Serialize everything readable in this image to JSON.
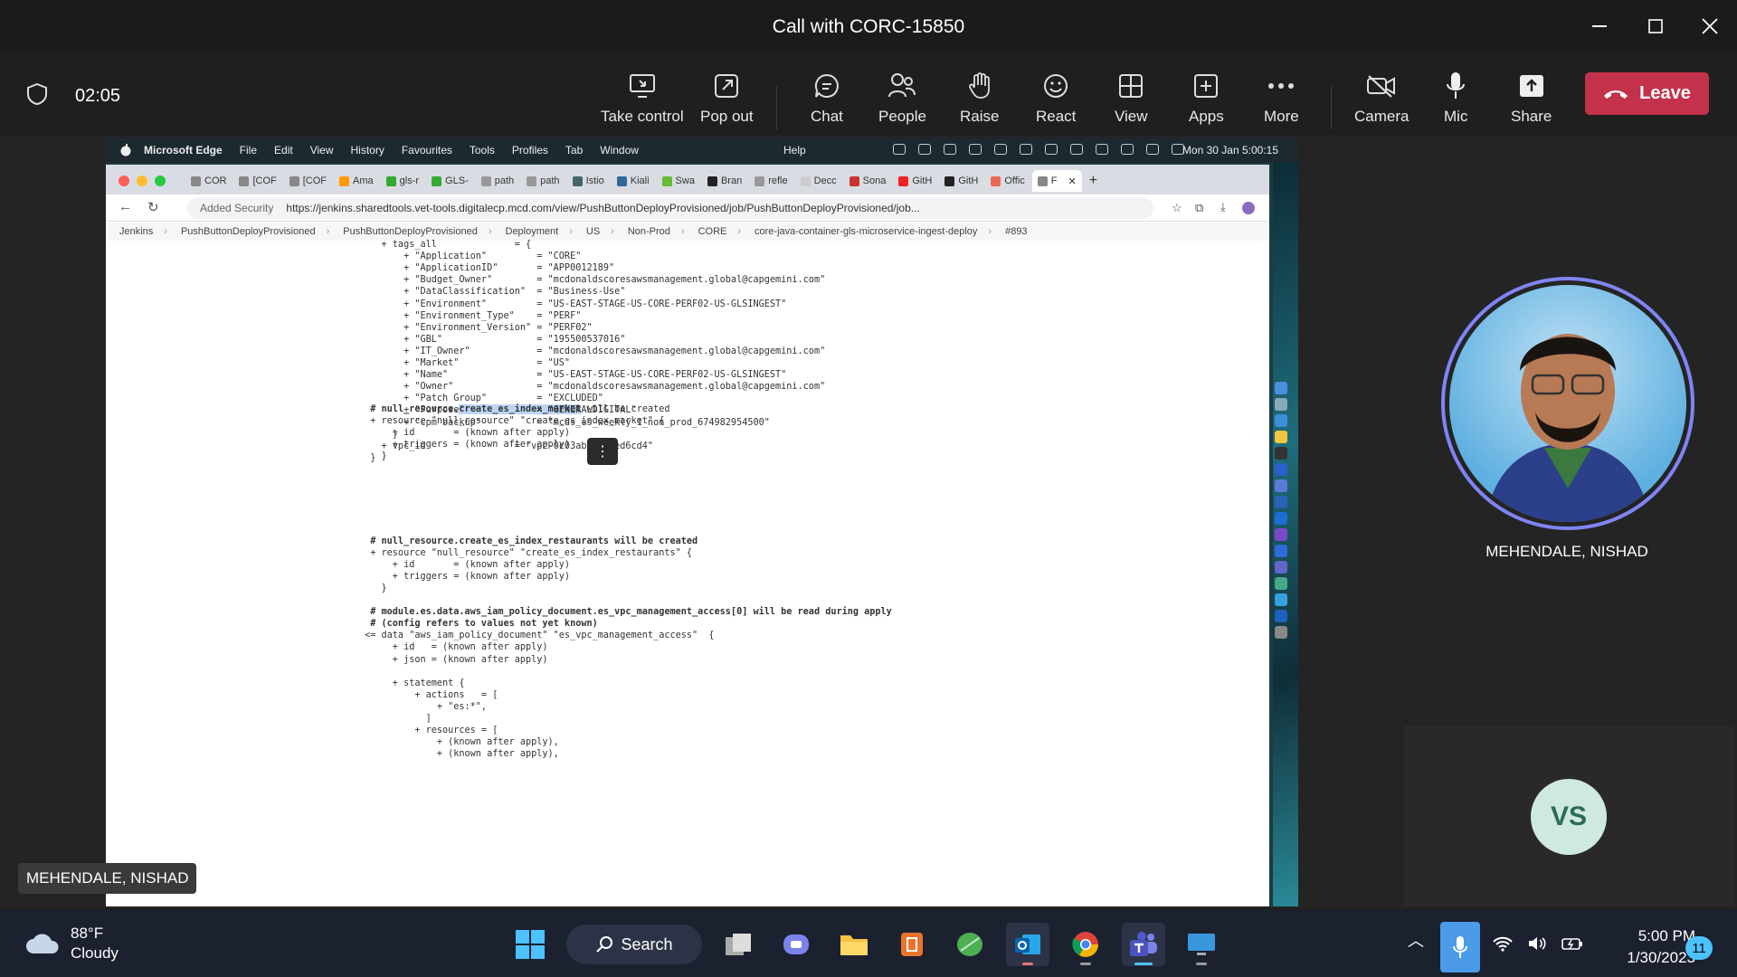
{
  "teams": {
    "window_title": "Call with CORC-15850",
    "timer": "02:05",
    "toolbar": [
      {
        "label": "Take control",
        "icon": "take-control-icon"
      },
      {
        "label": "Pop out",
        "icon": "pop-out-icon"
      },
      {
        "label": "Chat",
        "icon": "chat-icon"
      },
      {
        "label": "People",
        "icon": "people-icon"
      },
      {
        "label": "Raise",
        "icon": "raise-hand-icon"
      },
      {
        "label": "React",
        "icon": "react-icon"
      },
      {
        "label": "View",
        "icon": "view-icon"
      },
      {
        "label": "Apps",
        "icon": "apps-icon"
      },
      {
        "label": "More",
        "icon": "more-icon"
      },
      {
        "label": "Camera",
        "icon": "camera-off-icon"
      },
      {
        "label": "Mic",
        "icon": "mic-icon"
      },
      {
        "label": "Share",
        "icon": "share-icon"
      }
    ],
    "leave_label": "Leave",
    "leave_color": "#c4314b",
    "participant_name": "MEHENDALE, NISHAD",
    "vs_initials": "VS",
    "presenter_tag": "MEHENDALE, NISHAD"
  },
  "mac": {
    "app": "Microsoft Edge",
    "menus": [
      "File",
      "Edit",
      "View",
      "History",
      "Favourites",
      "Tools",
      "Profiles",
      "Tab",
      "Window"
    ],
    "help": "Help",
    "datetime": "Mon 30 Jan  5:00:15"
  },
  "browser": {
    "tabs": [
      "COR",
      "[COF",
      "[COF",
      "Ama",
      "gls-r",
      "GLS-",
      "path",
      "path",
      "Istio",
      "Kiali",
      "Swa",
      "Bran",
      "refle",
      "Decc",
      "Sona",
      "GitH",
      "GitH",
      "Offic",
      "F"
    ],
    "security": "Added Security",
    "url": "https://jenkins.sharedtools.vet-tools.digitalecp.mcd.com/view/PushButtonDeployProvisioned/job/PushButtonDeployProvisioned/job...",
    "breadcrumbs": [
      "Jenkins",
      "PushButtonDeployProvisioned",
      "PushButtonDeployProvisioned",
      "Deployment",
      "US",
      "Non-Prod",
      "CORE",
      "core-java-container-gls-microservice-ingest-deploy",
      "#893"
    ]
  },
  "console": {
    "lines": [
      "    + tags_all              = {",
      "        + \"Application\"         = \"CORE\"",
      "        + \"ApplicationID\"       = \"APP0012189\"",
      "        + \"Budget_Owner\"        = \"mcdonaldscoresawsmanagement.global@capgemini.com\"",
      "        + \"DataClassification\"  = \"Business-Use\"",
      "        + \"Environment\"         = \"US-EAST-STAGE-US-CORE-PERF02-US-GLSINGEST\"",
      "        + \"Environment_Type\"    = \"PERF\"",
      "        + \"Environment_Version\" = \"PERF02\"",
      "        + \"GBL\"                 = \"195500537016\"",
      "        + \"IT_Owner\"            = \"mcdonaldscoresawsmanagement.global@capgemini.com\"",
      "        + \"Market\"              = \"US\"",
      "        + \"Name\"                = \"US-EAST-STAGE-US-CORE-PERF02-US-GLSINGEST\"",
      "        + \"Owner\"               = \"mcdonaldscoresawsmanagement.global@capgemini.com\"",
      "        + \"Patch Group\"         = \"EXCLUDED\"",
      "        + \"Purpose\"             = \"GENERALDIGITAL\"",
      "        + \"cpm backup\"          = \"mcds_us_weekly_1_non_prod_674982954500\"",
      "      }",
      "    + vpc_id                = \"vpc-0c03ab927ceed6cd4\"",
      "  }",
      "",
      "",
      "",
      "",
      "",
      "",
      "  # null_resource.create_es_index_restaurants will be created",
      "  + resource \"null_resource\" \"create_es_index_restaurants\" {",
      "      + id       = (known after apply)",
      "      + triggers = (known after apply)",
      "    }",
      "",
      "  # module.es.data.aws_iam_policy_document.es_vpc_management_access[0] will be read during apply",
      "  # (config refers to values not yet known)",
      " <= data \"aws_iam_policy_document\" \"es_vpc_management_access\"  {",
      "      + id   = (known after apply)",
      "      + json = (known after apply)",
      "",
      "      + statement {",
      "          + actions   = [",
      "              + \"es:*\",",
      "            ]",
      "          + resources = [",
      "              + (known after apply),",
      "              + (known after apply),"
    ],
    "block": {
      "comment_prefix": "  # ",
      "resource_a": "null_resource.",
      "resource_hl": "create_es_index_market",
      "resource_tail": " will be created",
      "line2": "  + resource \"null_resource\" \"create_es_index_market\" {",
      "line3": "      + id       = (known after apply)",
      "line4": "      + triggers = (known after apply)",
      "line5": "    }"
    }
  },
  "taskbar": {
    "temp": "88°F",
    "condition": "Cloudy",
    "search_label": "Search",
    "time": "5:00 PM",
    "date": "1/30/2023",
    "notifications": "11"
  }
}
